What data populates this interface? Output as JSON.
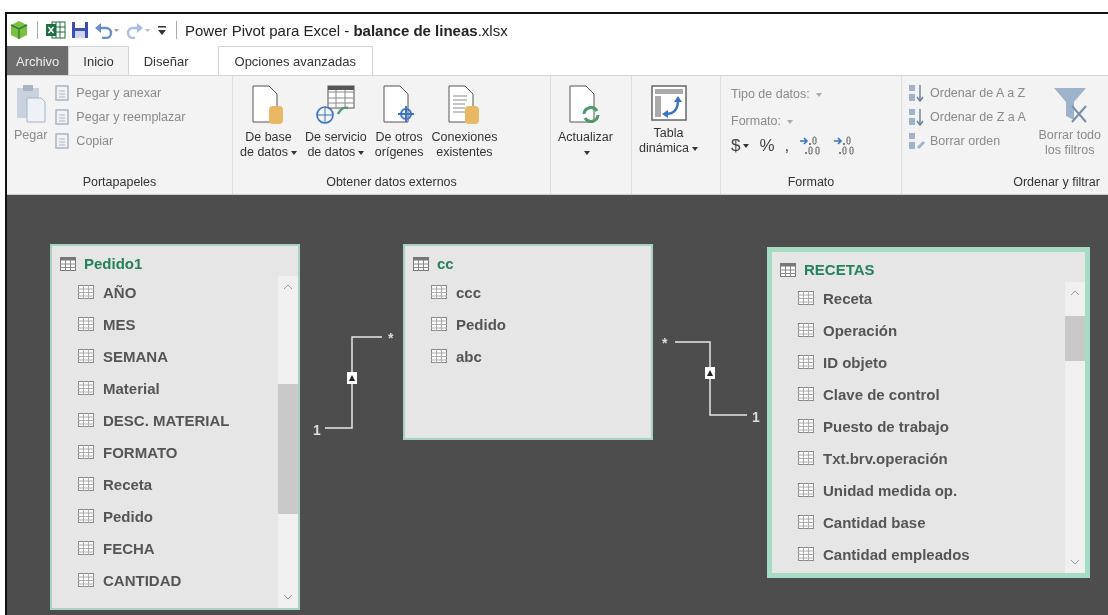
{
  "title_bar": {
    "title": "Power Pivot para Excel - **balance de lineas**.xlsx"
  },
  "tabs": [
    {
      "label": "Archivo",
      "kind": "file",
      "selected": false
    },
    {
      "label": "Inicio",
      "kind": "tab",
      "selected": true
    },
    {
      "label": "Diseñar",
      "kind": "tab",
      "selected": false
    },
    {
      "label": "Opciones avanzadas",
      "kind": "tab",
      "selected": false
    }
  ],
  "ribbon": {
    "groups": [
      {
        "label": "Portapapeles",
        "items": [
          {
            "lines": [
              "Pegar"
            ],
            "disabled": true
          },
          {
            "lines": [
              "Pegar y anexar"
            ],
            "disabled": true
          },
          {
            "lines": [
              "Pegar y reemplazar"
            ],
            "disabled": true
          },
          {
            "lines": [
              "Copiar"
            ],
            "disabled": true
          }
        ]
      },
      {
        "label": "Obtener datos externos",
        "items": [
          {
            "lines": [
              "De base",
              "de datos"
            ],
            "dropdown": true,
            "disabled": false
          },
          {
            "lines": [
              "De servicio",
              "de datos"
            ],
            "dropdown": true,
            "disabled": false
          },
          {
            "lines": [
              "De otros",
              "orígenes"
            ],
            "disabled": false
          },
          {
            "lines": [
              "Conexiones",
              "existentes"
            ],
            "disabled": false
          }
        ]
      },
      {
        "items": [
          {
            "lines": [
              "Actualizar"
            ],
            "dropdown": true,
            "disabled": false
          }
        ]
      },
      {
        "items": [
          {
            "lines": [
              "Tabla",
              "dinámica"
            ],
            "dropdown": true,
            "disabled": false
          }
        ]
      },
      {
        "label": "Formato",
        "items": [
          {
            "kind": "combo",
            "lines": [
              "Tipo de datos:"
            ],
            "disabled": true
          },
          {
            "kind": "combo",
            "lines": [
              "Formato:"
            ],
            "disabled": true
          },
          {
            "kind": "symbol",
            "lines": [
              "$"
            ],
            "dropdown": true,
            "disabled": false
          },
          {
            "kind": "symbol",
            "lines": [
              "%"
            ],
            "disabled": false
          },
          {
            "kind": "symbol",
            "lines": [
              ","
            ],
            "disabled": false
          },
          {
            "kind": "icon",
            "disabled": false
          },
          {
            "kind": "icon",
            "disabled": false
          }
        ]
      },
      {
        "label": "Ordenar y filtrar",
        "items": [
          {
            "lines": [
              "Ordenar de A a Z"
            ],
            "disabled": true
          },
          {
            "lines": [
              "Ordenar de Z a A"
            ],
            "disabled": true
          },
          {
            "lines": [
              "Borrar orden"
            ],
            "disabled": true
          },
          {
            "lines": [
              "Borrar todo",
              "los filtros"
            ],
            "disabled": true
          }
        ]
      }
    ]
  },
  "diagram": {
    "tables": [
      {
        "name": "Pedido1",
        "selected": false,
        "scrollable": true,
        "fields": [
          "AÑO",
          "MES",
          "SEMANA",
          "Material",
          "DESC. MATERIAL",
          "FORMATO",
          "Receta",
          "Pedido",
          "FECHA",
          "CANTIDAD"
        ]
      },
      {
        "name": "cc",
        "selected": false,
        "scrollable": false,
        "fields": [
          "ccc",
          "Pedido",
          "abc"
        ]
      },
      {
        "name": "RECETAS",
        "selected": true,
        "scrollable": true,
        "fields": [
          "Receta",
          "Operación",
          "ID objeto",
          "Clave de control",
          "Puesto de trabajo",
          "Txt.brv.operación",
          "Unidad medida op.",
          "Cantidad base",
          "Cantidad empleados"
        ]
      }
    ],
    "relationships": [
      {
        "one_label": "1",
        "many_label": "*"
      },
      {
        "one_label": "1",
        "many_label": "*"
      }
    ]
  }
}
